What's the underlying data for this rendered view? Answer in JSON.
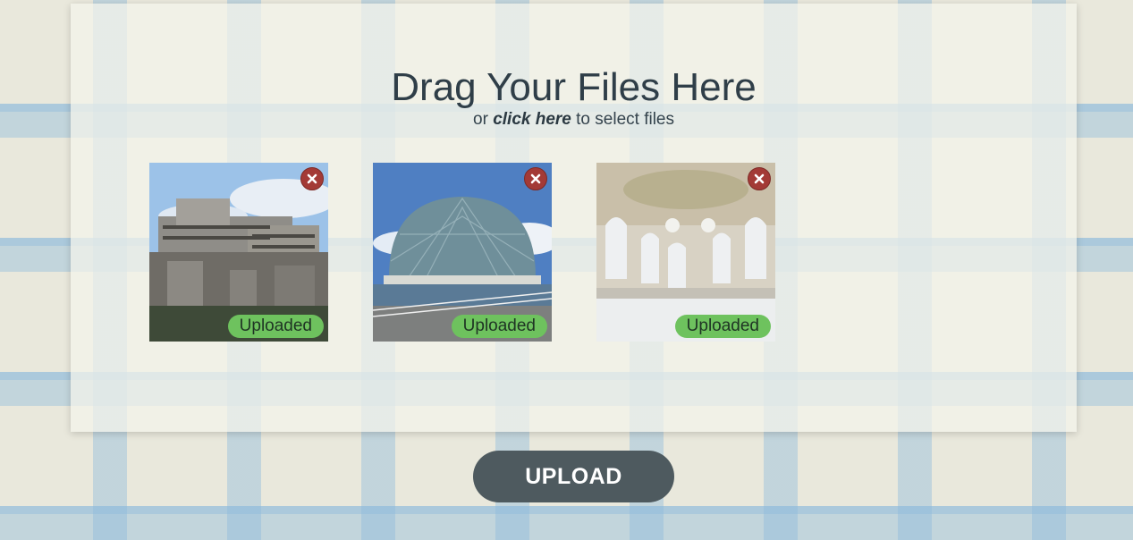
{
  "dropzone": {
    "title": "Drag Your Files Here",
    "subtitle_prefix": "or",
    "subtitle_link": "click here",
    "subtitle_suffix": "to select files"
  },
  "files": [
    {
      "status": "Uploaded",
      "remove_icon": "close-icon",
      "image": "brutalist-concrete-building"
    },
    {
      "status": "Uploaded",
      "remove_icon": "close-icon",
      "image": "glass-dome-on-water"
    },
    {
      "status": "Uploaded",
      "remove_icon": "close-icon",
      "image": "baroque-palace-hall"
    }
  ],
  "upload_button": {
    "label": "UPLOAD"
  },
  "colors": {
    "remove": "#a33a36",
    "status_badge": "#6ec25e",
    "upload_button": "#4e5a5f",
    "title": "#2f3e48"
  }
}
